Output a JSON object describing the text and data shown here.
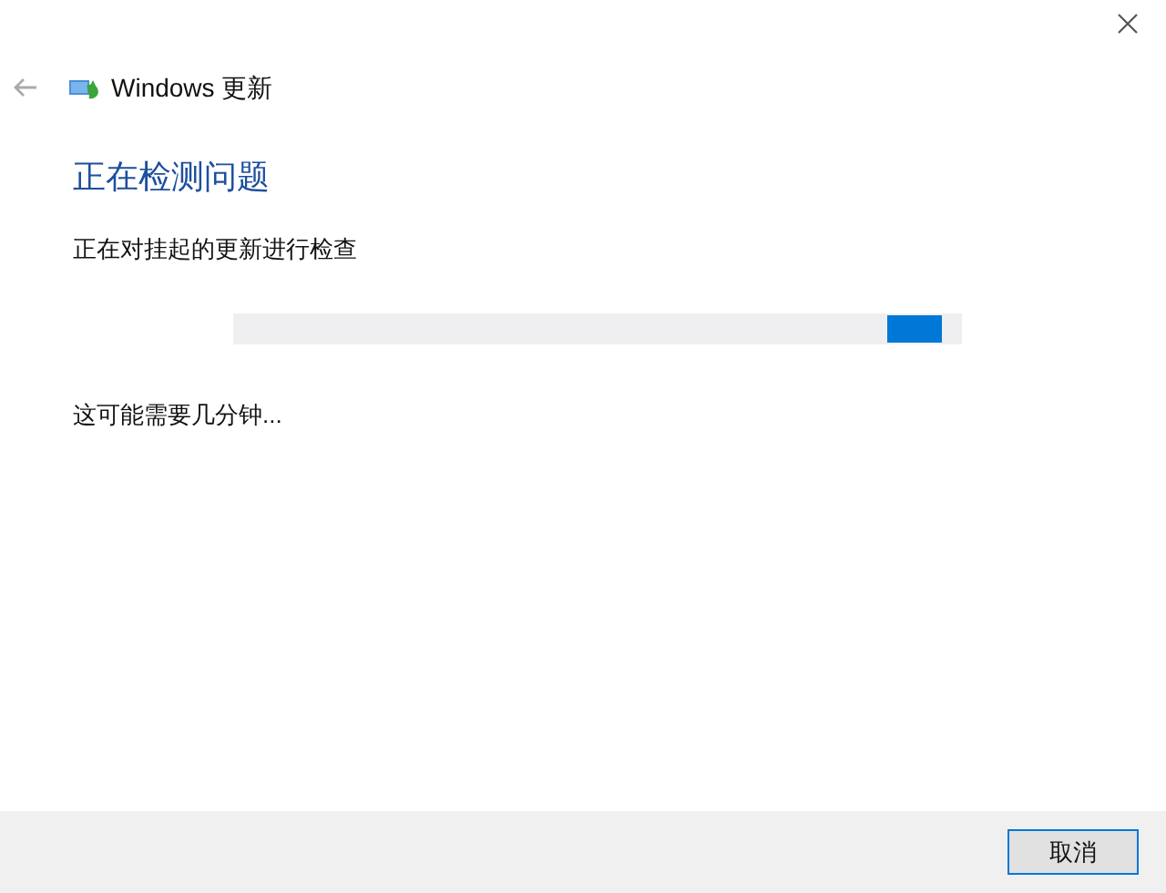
{
  "window": {
    "title": "Windows 更新"
  },
  "heading": "正在检测问题",
  "status": "正在对挂起的更新进行检查",
  "progress": {
    "indeterminate": true
  },
  "note": "这可能需要几分钟...",
  "buttons": [
    {
      "label": "取消",
      "selected": true
    }
  ]
}
